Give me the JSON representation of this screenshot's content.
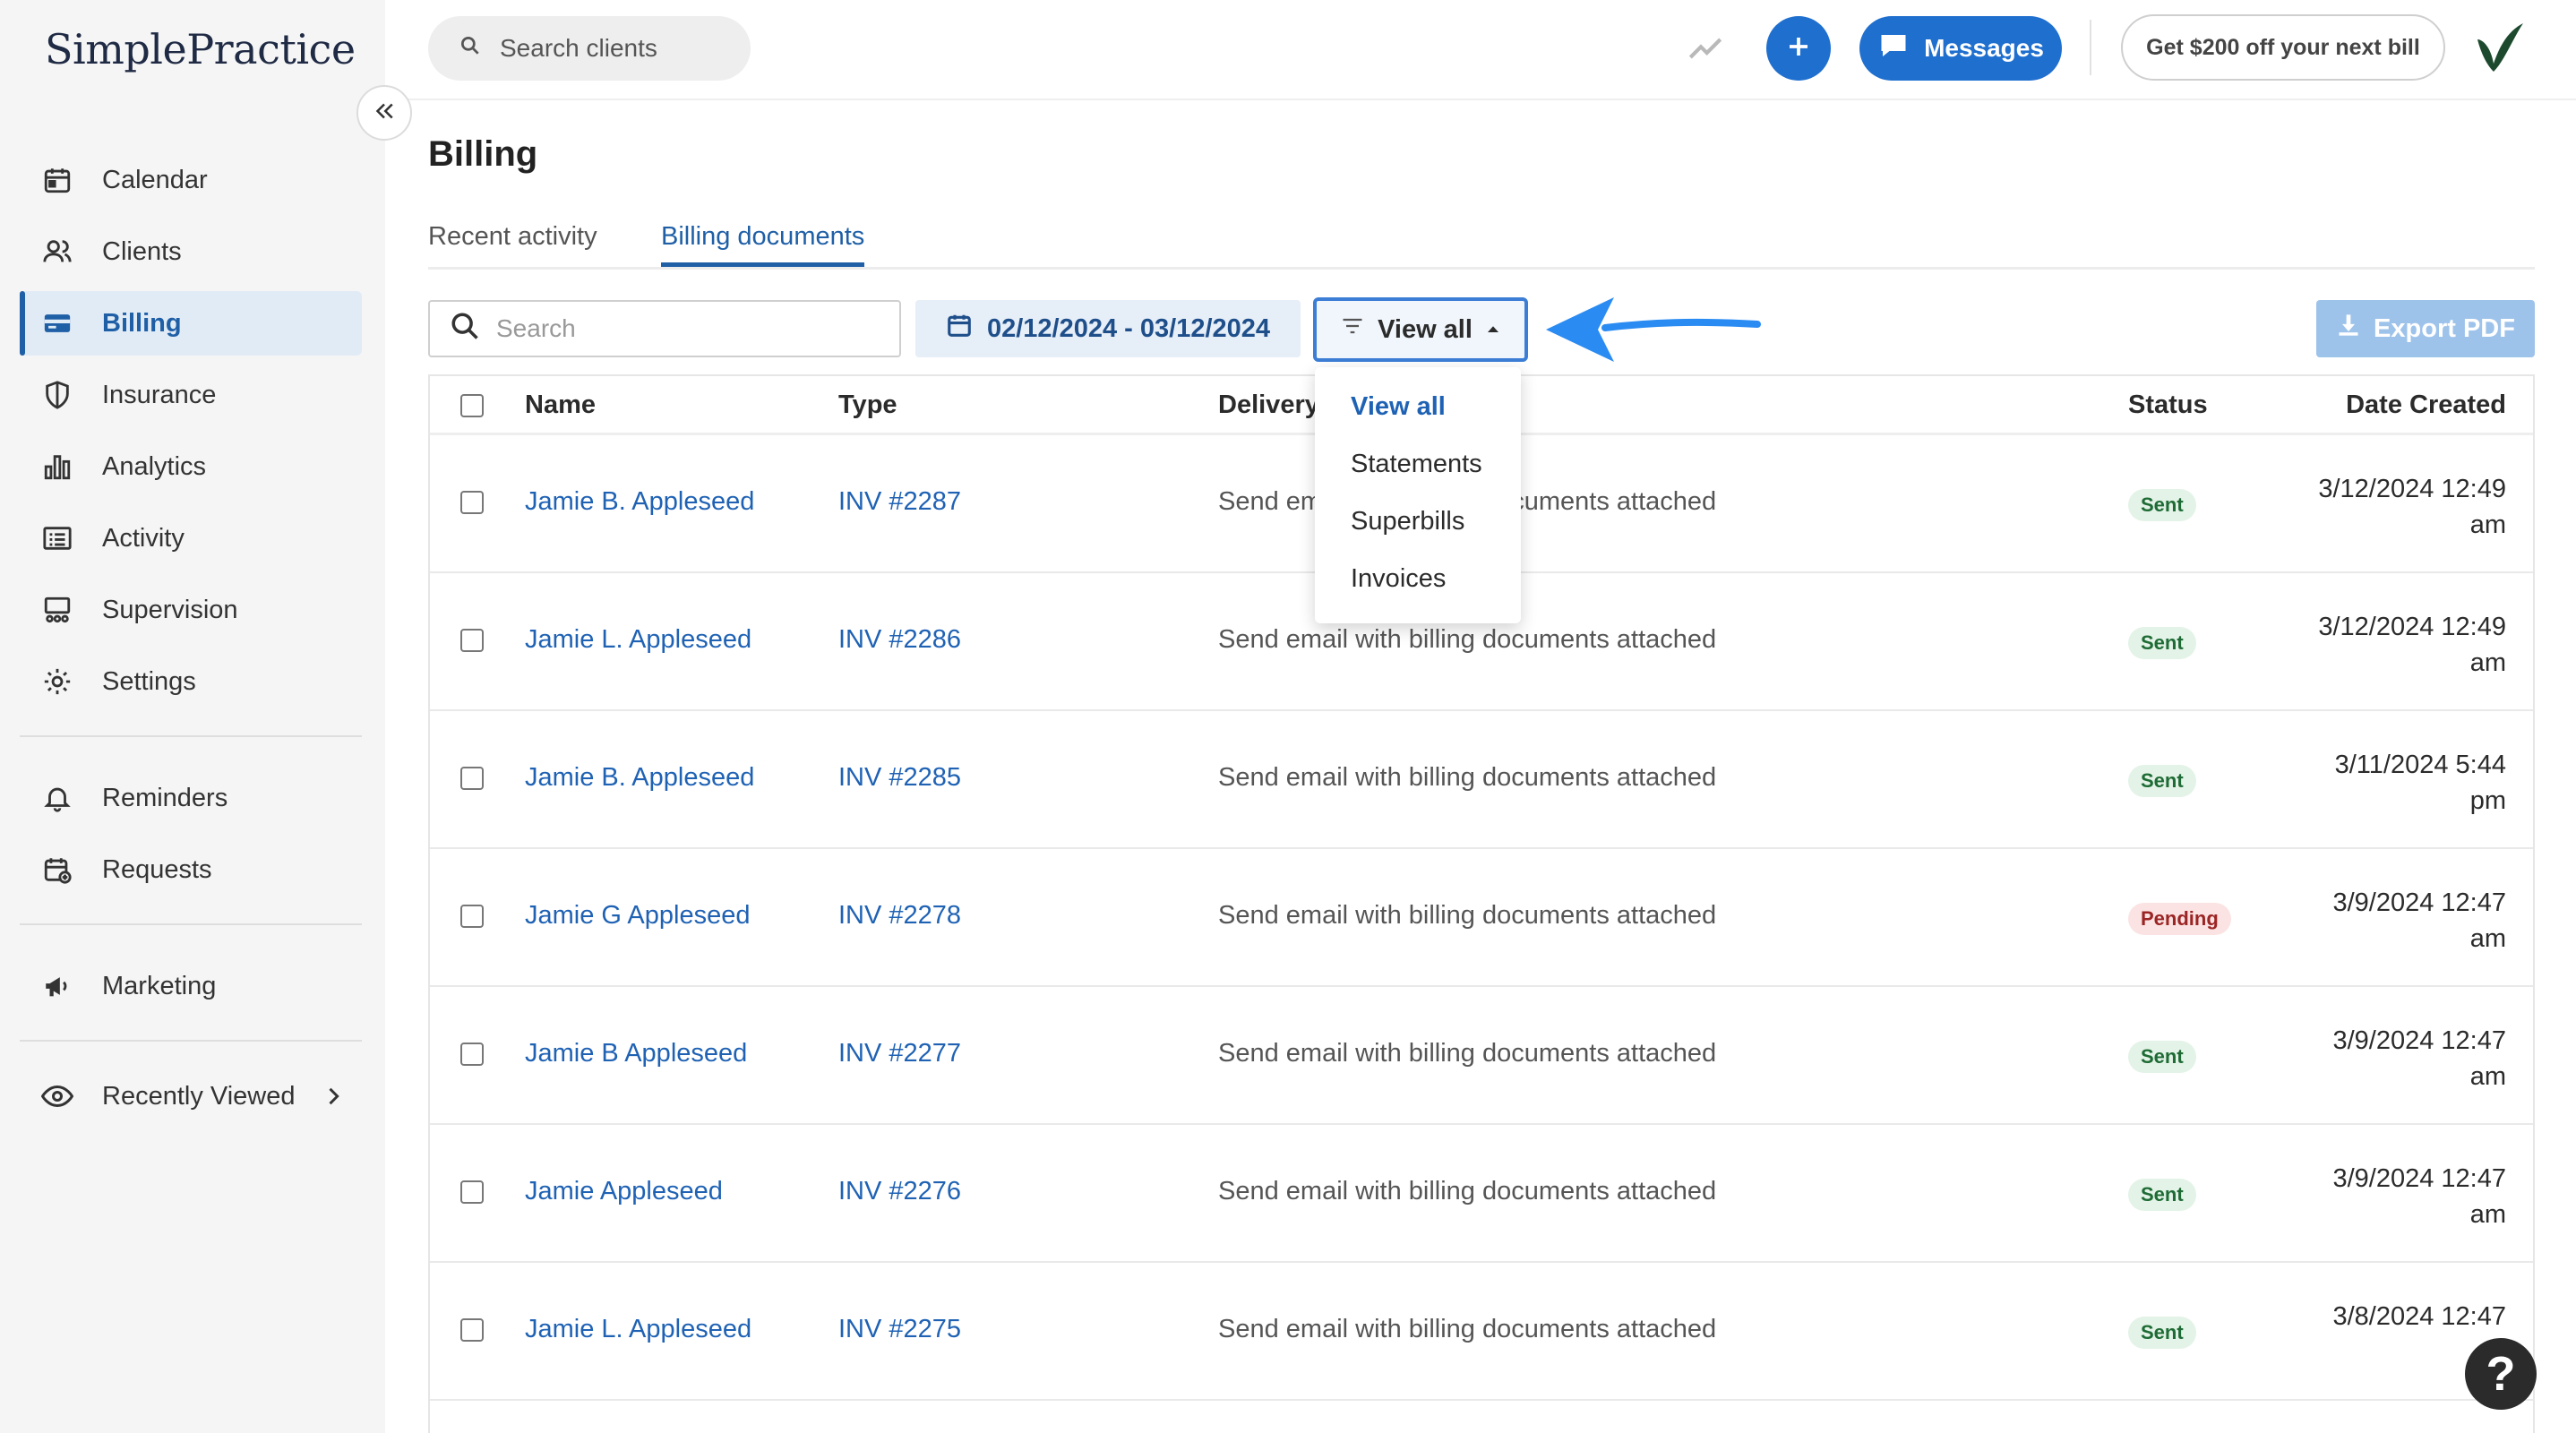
{
  "app": {
    "logo_text": "SimplePractice",
    "search_placeholder": "Search clients",
    "messages_label": "Messages",
    "promo_label": "Get $200 off your next bill"
  },
  "sidebar": {
    "items": [
      {
        "label": "Calendar",
        "icon": "calendar-icon"
      },
      {
        "label": "Clients",
        "icon": "clients-icon"
      },
      {
        "label": "Billing",
        "icon": "billing-icon",
        "active": true
      },
      {
        "label": "Insurance",
        "icon": "shield-icon"
      },
      {
        "label": "Analytics",
        "icon": "bar-chart-icon"
      },
      {
        "label": "Activity",
        "icon": "list-icon"
      },
      {
        "label": "Supervision",
        "icon": "supervision-icon"
      },
      {
        "label": "Settings",
        "icon": "gear-icon"
      },
      {
        "label": "Reminders",
        "icon": "bell-icon"
      },
      {
        "label": "Requests",
        "icon": "calendar-plus-icon"
      },
      {
        "label": "Marketing",
        "icon": "megaphone-icon"
      },
      {
        "label": "Recently Viewed",
        "icon": "eye-icon"
      }
    ]
  },
  "page": {
    "title": "Billing",
    "tabs": [
      {
        "label": "Recent activity"
      },
      {
        "label": "Billing documents",
        "active": true
      }
    ]
  },
  "toolbar": {
    "search_placeholder": "Search",
    "date_range": "02/12/2024 - 03/12/2024",
    "filter_label": "View all",
    "export_label": "Export PDF"
  },
  "filter_menu": {
    "options": [
      "View all",
      "Statements",
      "Superbills",
      "Invoices"
    ],
    "selected": "View all"
  },
  "table": {
    "columns": [
      "Name",
      "Type",
      "Delivery",
      "Status",
      "Date Created"
    ],
    "rows": [
      {
        "name": "Jamie B. Appleseed",
        "type": "INV #2287",
        "delivery": "Send email with billing documents attached",
        "status": "Sent",
        "date_line1": "3/12/2024 12:49",
        "date_line2": "am"
      },
      {
        "name": "Jamie L. Appleseed",
        "type": "INV #2286",
        "delivery": "Send email with billing documents attached",
        "status": "Sent",
        "date_line1": "3/12/2024 12:49",
        "date_line2": "am"
      },
      {
        "name": "Jamie B. Appleseed",
        "type": "INV #2285",
        "delivery": "Send email with billing documents attached",
        "status": "Sent",
        "date_line1": "3/11/2024 5:44",
        "date_line2": "pm"
      },
      {
        "name": "Jamie G Appleseed",
        "type": "INV #2278",
        "delivery": "Send email with billing documents attached",
        "status": "Pending",
        "date_line1": "3/9/2024 12:47",
        "date_line2": "am"
      },
      {
        "name": "Jamie B Appleseed",
        "type": "INV #2277",
        "delivery": "Send email with billing documents attached",
        "status": "Sent",
        "date_line1": "3/9/2024 12:47",
        "date_line2": "am"
      },
      {
        "name": "Jamie Appleseed",
        "type": "INV #2276",
        "delivery": "Send email with billing documents attached",
        "status": "Sent",
        "date_line1": "3/9/2024 12:47",
        "date_line2": "am"
      },
      {
        "name": "Jamie L. Appleseed",
        "type": "INV #2275",
        "delivery": "Send email with billing documents attached",
        "status": "Sent",
        "date_line1": "3/8/2024 12:47",
        "date_line2": ""
      }
    ]
  },
  "help_label": "?",
  "colors": {
    "accent": "#1f6fcf",
    "link": "#1f62b4",
    "annotation_arrow": "#2a8bf2"
  }
}
